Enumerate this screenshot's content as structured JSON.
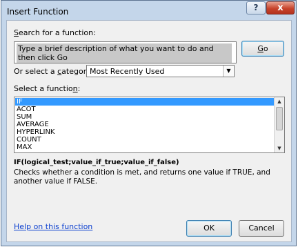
{
  "window": {
    "title": "Insert Function",
    "help_glyph": "?",
    "close_glyph": "x"
  },
  "search": {
    "label_prefix": "",
    "label_accel": "S",
    "label_rest": "earch for a function:",
    "text": "Type a brief description of what you want to do and then click Go",
    "go_accel": "G",
    "go_rest": "o"
  },
  "category": {
    "label_prefix": "Or select a ",
    "label_accel": "c",
    "label_rest": "ategory:",
    "selected": "Most Recently Used"
  },
  "functions": {
    "label_prefix": "Select a functio",
    "label_accel": "n",
    "label_rest": ":",
    "items": [
      "IF",
      "ACOT",
      "SUM",
      "AVERAGE",
      "HYPERLINK",
      "COUNT",
      "MAX"
    ],
    "selected_index": 0
  },
  "details": {
    "signature": "IF(logical_test;value_if_true;value_if_false)",
    "description": "Checks whether a condition is met, and returns one value if TRUE, and another value if FALSE."
  },
  "footer": {
    "help_link": "Help on this function",
    "ok": "OK",
    "cancel": "Cancel"
  },
  "icons": {
    "list_scroll_up": "up-arrow-icon",
    "list_scroll_down": "down-arrow-icon",
    "dropdown": "chevron-down-icon"
  },
  "colors": {
    "selection": "#3399ff",
    "link": "#0b3fcf",
    "close_button": "#c7432b"
  }
}
